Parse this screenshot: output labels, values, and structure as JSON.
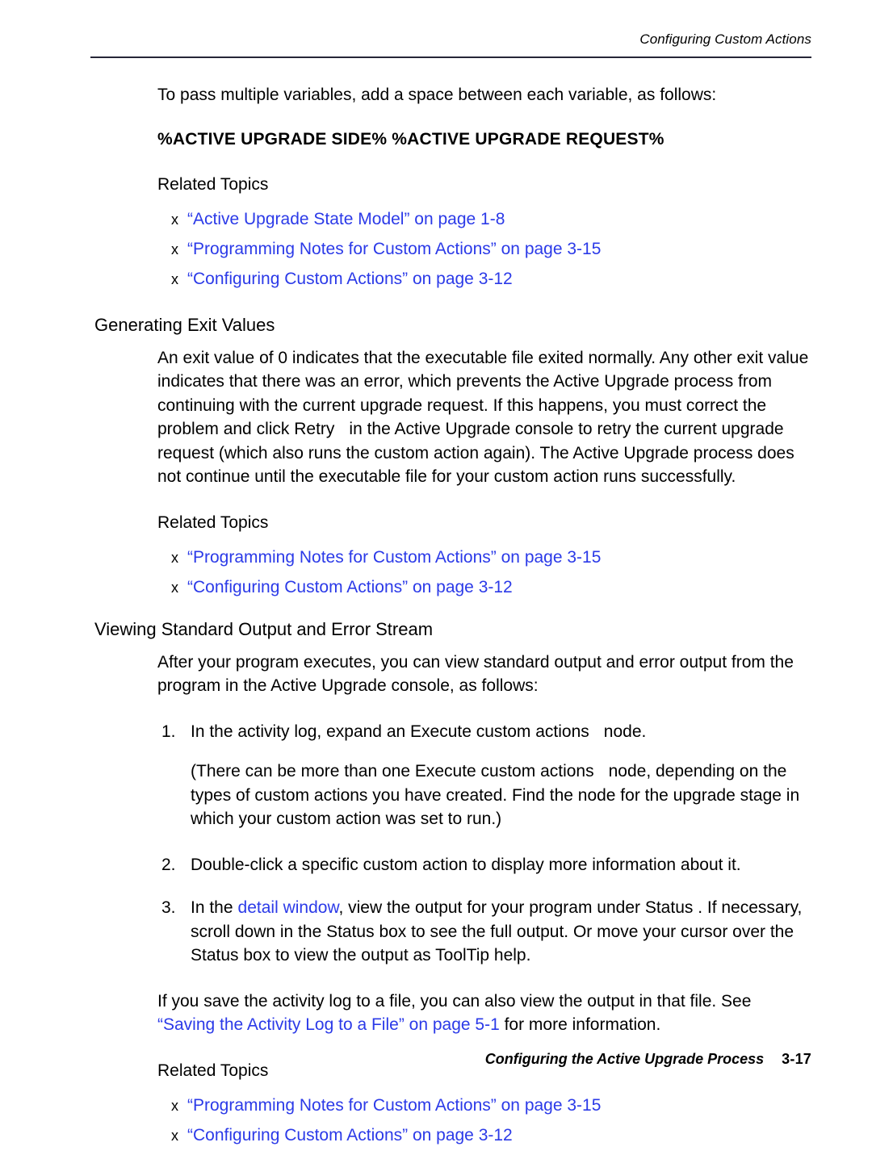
{
  "header": {
    "running_title": "Configuring Custom Actions"
  },
  "body": {
    "intro_paragraph": "To pass multiple variables, add a space between each variable, as follows:",
    "variable_example": "%ACTIVE UPGRADE SIDE% %ACTIVE UPGRADE REQUEST%",
    "related_topics_label": "Related Topics",
    "related_topics_1": [
      {
        "bullet": "x",
        "link": "“Active Upgrade State Model” on page 1-8"
      },
      {
        "bullet": "x",
        "link": "“Programming Notes for Custom Actions” on page 3-15"
      },
      {
        "bullet": "x",
        "link": "“Configuring Custom Actions” on page 3-12"
      }
    ],
    "section_exit_values": {
      "heading": "Generating Exit Values",
      "paragraph_a": "An exit value of 0 indicates that the executable file exited normally. Any other exit value indicates that there was an error, which prevents the Active Upgrade process from continuing with the current upgrade request. If this happens, you must correct the problem and click Retry",
      "paragraph_b": "in the Active Upgrade console to retry the current upgrade request (which also runs the custom action again). The Active Upgrade process does not continue until the executable file for your custom action runs successfully.",
      "related_topics_label": "Related Topics",
      "related_topics": [
        {
          "bullet": "x",
          "link": "“Programming Notes for Custom Actions” on page 3-15"
        },
        {
          "bullet": "x",
          "link": "“Configuring Custom Actions” on page 3-12"
        }
      ]
    },
    "section_viewing_output": {
      "heading": "Viewing Standard Output and Error Stream",
      "intro": "After your program executes, you can view standard output and error output from the program in the Active Upgrade console, as follows:",
      "steps": [
        {
          "number": "1.",
          "text_before": "In the activity log, expand an Execute custom actions",
          "text_after": "node."
        },
        {
          "number": "2.",
          "text_before": "Double-click a specific custom action to display more information about it.",
          "text_after": ""
        },
        {
          "number": "3.",
          "text_before": "In the",
          "link": "detail window",
          "text_after": ", view the output for your program under Status . If necessary, scroll down in the Status  box to see the full output. Or move your cursor over the Status  box to view the output as ToolTip help."
        }
      ],
      "step1_note_before": "(There can be more than one Execute custom actions",
      "step1_note_after": "node, depending on the types of custom actions you have created. Find the node for the upgrade stage in which your custom action was set to run.)",
      "closing_before": "If you save the activity log to a file, you can also view the output in that file. See ",
      "closing_link": "“Saving the Activity Log to a File” on page 5-1",
      "closing_after": " for more information.",
      "related_topics_label": "Related Topics",
      "related_topics": [
        {
          "bullet": "x",
          "link": "“Programming Notes for Custom Actions” on page 3-15"
        },
        {
          "bullet": "x",
          "link": "“Configuring Custom Actions” on page 3-12"
        }
      ]
    }
  },
  "footer": {
    "title": "Configuring the Active Upgrade Process",
    "page_number": "3-17"
  },
  "colors": {
    "link": "#2b3ae8",
    "rule": "#262637",
    "text": "#000000",
    "background": "#ffffff"
  }
}
